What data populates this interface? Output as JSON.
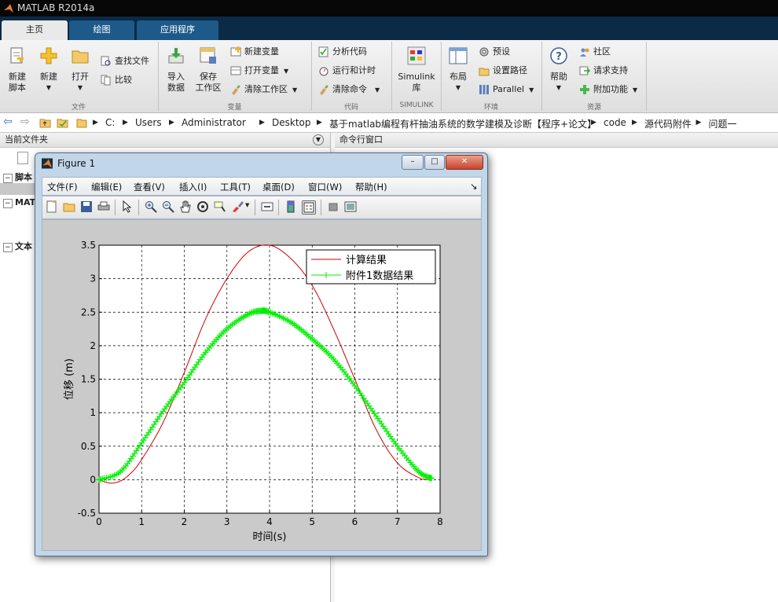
{
  "app": {
    "title": "MATLAB R2014a"
  },
  "tabs": [
    {
      "label": "主页"
    },
    {
      "label": "绘图"
    },
    {
      "label": "应用程序"
    }
  ],
  "ribbon": {
    "file": {
      "new_script": "新建\n脚本",
      "new": "新建",
      "open": "打开",
      "find_files": "查找文件",
      "compare": "比较",
      "group_label": "文件"
    },
    "variable": {
      "import_data": "导入\n数据",
      "save_workspace": "保存\n工作区",
      "new_variable": "新建变量",
      "open_variable": "打开变量",
      "clear_workspace": "清除工作区",
      "group_label": "变量"
    },
    "code": {
      "analyze_code": "分析代码",
      "run_and_time": "运行和计时",
      "clear_commands": "清除命令",
      "group_label": "代码"
    },
    "simulink": {
      "library": "Simulink\n库",
      "group_label": "SIMULINK"
    },
    "environment": {
      "layout": "布局",
      "preferences": "预设",
      "set_path": "设置路径",
      "parallel": "Parallel",
      "group_label": "环境"
    },
    "resources": {
      "help": "帮助",
      "community": "社区",
      "request_support": "请求支持",
      "add_ons": "附加功能",
      "group_label": "资源"
    }
  },
  "address": {
    "crumbs": [
      "C:",
      "Users",
      "Administrator",
      "Desktop",
      "基于matlab编程有杆抽油系统的数学建模及诊断【程序+论文】",
      "code",
      "源代码附件",
      "问题一"
    ]
  },
  "left_panel": {
    "title": "当前文件夹",
    "items": [
      "脚本",
      "MATL",
      "文本"
    ]
  },
  "right_panel": {
    "title": "命令行窗口"
  },
  "figure": {
    "title": "Figure 1",
    "menus": [
      "文件(F)",
      "编辑(E)",
      "查看(V)",
      "插入(I)",
      "工具(T)",
      "桌面(D)",
      "窗口(W)",
      "帮助(H)"
    ]
  },
  "chart_data": {
    "type": "line",
    "title": "",
    "xlabel": "时间(s)",
    "ylabel": "位移 (m)",
    "xlim": [
      0,
      8
    ],
    "ylim": [
      -0.5,
      3.5
    ],
    "xticks": [
      "0",
      "1",
      "2",
      "3",
      "4",
      "5",
      "6",
      "7",
      "8"
    ],
    "yticks": [
      "-0.5",
      "0",
      "0.5",
      "1",
      "1.5",
      "2",
      "2.5",
      "3",
      "3.5"
    ],
    "grid": true,
    "legend_position": "top-right",
    "series": [
      {
        "name": "计算结果",
        "color": "#cc0000",
        "marker": "none",
        "x": [
          0,
          0.25,
          0.5,
          0.75,
          1.0,
          1.5,
          2.0,
          2.5,
          3.0,
          3.5,
          4.0,
          4.5,
          5.0,
          5.5,
          6.0,
          6.5,
          7.0,
          7.5,
          7.8
        ],
        "y": [
          0.0,
          -0.05,
          -0.02,
          0.1,
          0.3,
          0.85,
          1.6,
          2.4,
          3.0,
          3.4,
          3.5,
          3.3,
          2.9,
          2.25,
          1.5,
          0.75,
          0.25,
          0.03,
          0.0
        ]
      },
      {
        "name": "附件1数据结果",
        "color": "#00ee00",
        "marker": "+",
        "x": [
          0,
          0.5,
          1.0,
          1.5,
          2.0,
          2.5,
          3.0,
          3.5,
          3.8,
          4.0,
          4.5,
          5.0,
          5.5,
          6.0,
          6.5,
          7.0,
          7.5,
          7.8
        ],
        "y": [
          0.0,
          0.12,
          0.55,
          1.02,
          1.45,
          1.9,
          2.25,
          2.47,
          2.52,
          2.5,
          2.35,
          2.1,
          1.8,
          1.4,
          0.95,
          0.5,
          0.12,
          0.02
        ]
      }
    ]
  }
}
